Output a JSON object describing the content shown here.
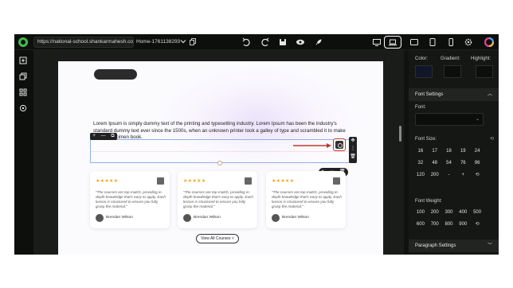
{
  "topbar": {
    "url": "https://national-school.shankarmahesh.com/",
    "page_selector": "Home-1761138293"
  },
  "canvas": {
    "body_text": "Lorem Ipsum is simply dummy text of the printing and typesetting industry. Lorem Ipsum has been the industry's standard dummy text ever since the 1500s, when an unknown printer took a galley of type and scrambled it to make a type specimen book.",
    "stars": "★★★★★",
    "testimonials": [
      {
        "quote": "\"The courses are top-match, providing in-depth knowledge that's easy to apply. Each lesson is structured to ensure you fully grasp the material.\"",
        "author": "Brendan Wilson"
      },
      {
        "quote": "\"The courses are top-match, providing in-depth knowledge that's easy to apply. Each lesson is structured to ensure you fully grasp the material.\"",
        "author": "Brendan Wilson"
      },
      {
        "quote": "\"The courses are top-match, providing in-depth knowledge that's easy to apply. Each lesson is structured to ensure you fully grasp the material.\"",
        "author": "Brendan Wilson"
      }
    ],
    "view_all": "View All Courses ˅"
  },
  "panel": {
    "color_label": "Color:",
    "gradient_label": "Gradient:",
    "highlight_label": "Highlight:",
    "font_settings": "Font Settings",
    "font_label": "Font:",
    "font_size_label": "Font Size:",
    "font_sizes": [
      "16",
      "17",
      "18",
      "19",
      "24",
      "32",
      "48",
      "54",
      "76",
      "96",
      "120",
      "200",
      "-",
      "+",
      "⟲"
    ],
    "font_weight_label": "Font Weight:",
    "font_weights": [
      "100",
      "200",
      "300",
      "400",
      "500",
      "600",
      "700",
      "800",
      "900",
      "⟲"
    ],
    "paragraph_settings": "Paragraph Settings"
  },
  "colors": {
    "accent_red": "#c0392b",
    "logo_green": "#3fbf4a",
    "star": "#f4a41a",
    "selection": "#8fb0ea"
  }
}
